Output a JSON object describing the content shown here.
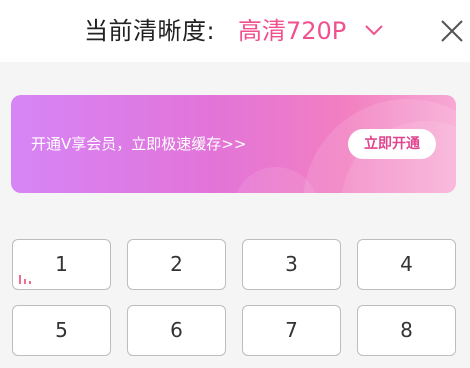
{
  "header": {
    "label": "当前清晰度:",
    "quality": "高清720P",
    "icons": {
      "dropdown": "chevron-down-icon",
      "close": "close-icon"
    }
  },
  "banner": {
    "text": "开通V享会员，立即极速缓存>>",
    "button": "立即开通"
  },
  "episodes": [
    "1",
    "2",
    "3",
    "4",
    "5",
    "6",
    "7",
    "8"
  ],
  "current_episode_icon": "playing-bars-icon",
  "colors": {
    "accent": "#f0518e",
    "banner_start": "#d685f7",
    "banner_end": "#f7a9d4",
    "playing_indicator": "#f26c8e"
  }
}
